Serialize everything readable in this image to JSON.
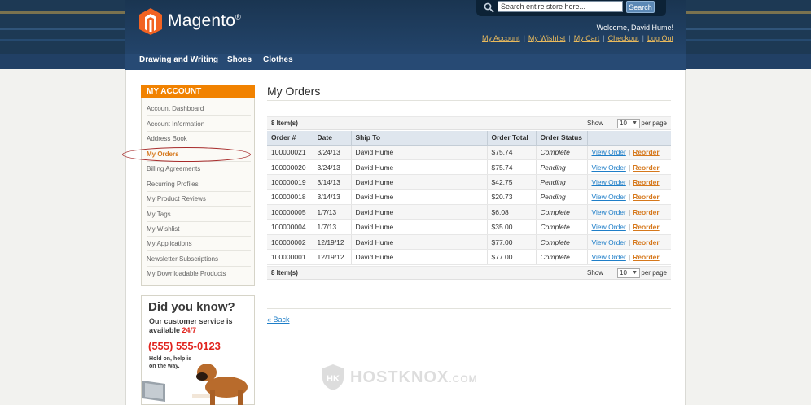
{
  "header": {
    "logo_text": "Magento",
    "logo_mark": "®",
    "search_placeholder": "Search entire store here...",
    "search_button": "Search",
    "welcome": "Welcome, David Hume!",
    "links": [
      "My Account",
      "My Wishlist",
      "My Cart",
      "Checkout",
      "Log Out"
    ]
  },
  "nav": [
    "Drawing and Writing",
    "Shoes",
    "Clothes"
  ],
  "sidebar": {
    "title": "MY ACCOUNT",
    "items": [
      "Account Dashboard",
      "Account Information",
      "Address Book",
      "My Orders",
      "Billing Agreements",
      "Recurring Profiles",
      "My Product Reviews",
      "My Tags",
      "My Wishlist",
      "My Applications",
      "Newsletter Subscriptions",
      "My Downloadable Products"
    ],
    "active_index": 3
  },
  "promo": {
    "heading": "Did you know?",
    "line1": "Our customer service is",
    "line2_prefix": "available ",
    "line2_highlight": "24/7",
    "phone": "(555) 555-0123",
    "note1": "Hold on, help is",
    "note2": "on the way."
  },
  "main": {
    "title": "My Orders",
    "item_count": "8 Item(s)",
    "show_label": "Show",
    "per_page_value": "10",
    "per_page_label": "per page",
    "columns": [
      "Order #",
      "Date",
      "Ship To",
      "Order Total",
      "Order Status",
      ""
    ],
    "rows": [
      [
        "100000021",
        "3/24/13",
        "David Hume",
        "$75.74",
        "Complete"
      ],
      [
        "100000020",
        "3/24/13",
        "David Hume",
        "$75.74",
        "Pending"
      ],
      [
        "100000019",
        "3/14/13",
        "David Hume",
        "$42.75",
        "Pending"
      ],
      [
        "100000018",
        "3/14/13",
        "David Hume",
        "$20.73",
        "Pending"
      ],
      [
        "100000005",
        "1/7/13",
        "David Hume",
        "$6.08",
        "Complete"
      ],
      [
        "100000004",
        "1/7/13",
        "David Hume",
        "$35.00",
        "Complete"
      ],
      [
        "100000002",
        "12/19/12",
        "David Hume",
        "$77.00",
        "Complete"
      ],
      [
        "100000001",
        "12/19/12",
        "David Hume",
        "$77.00",
        "Complete"
      ]
    ],
    "view_order_label": "View Order",
    "reorder_label": "Reorder",
    "back_label": "« Back"
  },
  "watermark": {
    "text": "HOSTKNOX",
    "suffix": ".COM"
  },
  "colors": {
    "accent": "#f18200",
    "link": "#1e7ec8",
    "reorder": "#d6781c",
    "header": "#1d3954"
  }
}
